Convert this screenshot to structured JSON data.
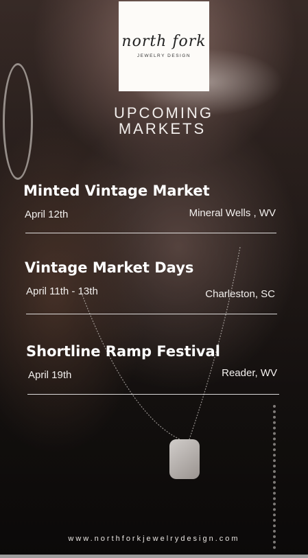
{
  "brand": {
    "logo_script": "north fork",
    "logo_sub": "JEWELRY DESIGN"
  },
  "header": {
    "line1": "UPCOMING",
    "line2": "MARKETS"
  },
  "events": [
    {
      "name": "Minted Vintage Market",
      "date": "April  12th",
      "location": "Mineral Wells , WV"
    },
    {
      "name": "Vintage Market Days",
      "date": "April 11th - 13th",
      "location": "Charleston, SC"
    },
    {
      "name": "Shortline Ramp Festival",
      "date": "April 19th",
      "location": "Reader, WV"
    }
  ],
  "footer": {
    "website": "www.northforkjewelrydesign.com"
  }
}
